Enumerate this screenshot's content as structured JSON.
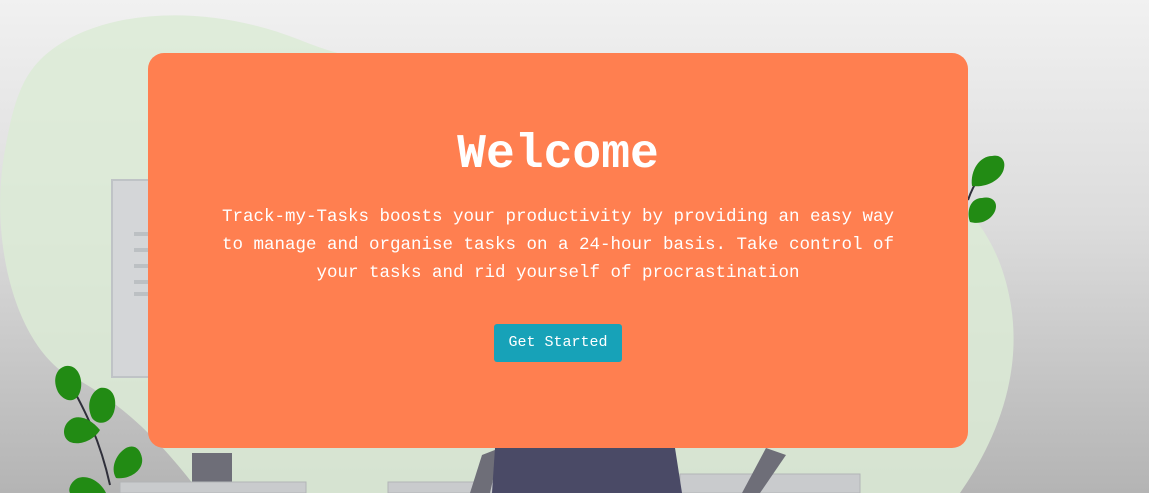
{
  "hero": {
    "title": "Welcome",
    "description": "Track-my-Tasks boosts your productivity by providing an easy way to manage and organise tasks on a 24-hour basis. Take control of your tasks and rid yourself of procrastination",
    "cta_label": "Get Started"
  },
  "colors": {
    "card_background": "#ff7f50",
    "button_background": "#17a2b8",
    "text": "#ffffff",
    "leaf_green": "#228b14",
    "blob_green": "#dcebd6"
  },
  "illustration": {
    "icons": [
      "leaf-sprig-icon",
      "person-illustration",
      "whiteboard-illustration",
      "desk-illustration"
    ]
  }
}
